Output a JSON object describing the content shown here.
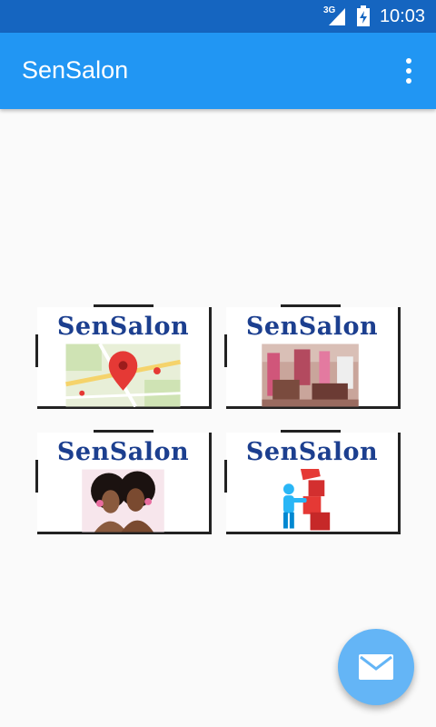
{
  "status_bar": {
    "network": "3G",
    "time": "10:03"
  },
  "app_bar": {
    "title": "SenSalon",
    "overflow_icon": "more-vert-icon"
  },
  "tiles": [
    {
      "label": "SenSalon",
      "image": "map-location-pin"
    },
    {
      "label": "SenSalon",
      "image": "salon-interior-photo"
    },
    {
      "label": "SenSalon",
      "image": "hairstyle-women"
    },
    {
      "label": "SenSalon",
      "image": "figure-with-red-blocks"
    }
  ],
  "fab": {
    "icon": "mail-icon"
  },
  "colors": {
    "status_bar": "#1565c0",
    "app_bar": "#2196f3",
    "fab": "#64b5f6",
    "tile_label": "#1c3f8f",
    "background": "#fafafa"
  }
}
